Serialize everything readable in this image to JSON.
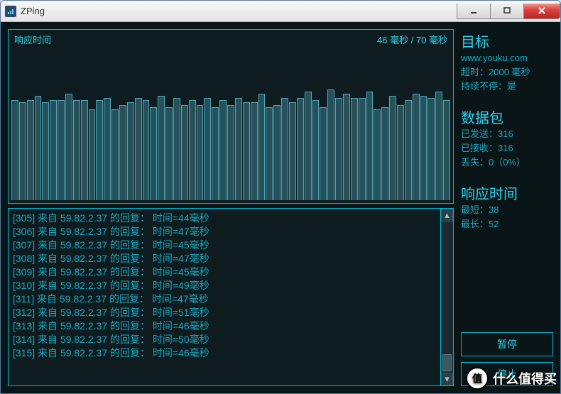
{
  "window": {
    "title": "ZPing"
  },
  "chart": {
    "label": "响应时间",
    "stats": "46 毫秒 / 70 毫秒"
  },
  "chart_data": {
    "type": "bar",
    "title": "响应时间",
    "ylabel": "毫秒",
    "ylim": [
      0,
      70
    ],
    "values": [
      46,
      45,
      46,
      48,
      45,
      46,
      46,
      49,
      46,
      46,
      42,
      46,
      47,
      42,
      44,
      45,
      47,
      46,
      43,
      48,
      43,
      47,
      44,
      46,
      44,
      47,
      43,
      46,
      44,
      47,
      45,
      45,
      49,
      43,
      44,
      47,
      45,
      47,
      50,
      46,
      43,
      51,
      47,
      49,
      47,
      47,
      50,
      42,
      43,
      48,
      44,
      46,
      49,
      48,
      47,
      50,
      46
    ]
  },
  "log": {
    "lines": [
      {
        "seq": 305,
        "ip": "59.82.2.37",
        "ms": 44
      },
      {
        "seq": 306,
        "ip": "59.82.2.37",
        "ms": 47
      },
      {
        "seq": 307,
        "ip": "59.82.2.37",
        "ms": 45
      },
      {
        "seq": 308,
        "ip": "59.82.2.37",
        "ms": 47
      },
      {
        "seq": 309,
        "ip": "59.82.2.37",
        "ms": 45
      },
      {
        "seq": 310,
        "ip": "59.82.2.37",
        "ms": 49
      },
      {
        "seq": 311,
        "ip": "59.82.2.37",
        "ms": 47
      },
      {
        "seq": 312,
        "ip": "59.82.2.37",
        "ms": 51
      },
      {
        "seq": 313,
        "ip": "59.82.2.37",
        "ms": 46
      },
      {
        "seq": 314,
        "ip": "59.82.2.37",
        "ms": 50
      },
      {
        "seq": 315,
        "ip": "59.82.2.37",
        "ms": 46
      }
    ],
    "template_prefix": "[",
    "template_mid1": "] 来自 ",
    "template_mid2": " 的回复： 时间=",
    "template_suffix": "毫秒"
  },
  "target": {
    "title": "目标",
    "host": "www.youku.com",
    "timeout_label": "超时：",
    "timeout_value": "2000 毫秒",
    "continuous_label": "持续不停：",
    "continuous_value": "是"
  },
  "packets": {
    "title": "数据包",
    "sent_label": "已发送：",
    "sent": 316,
    "recv_label": "已接收：",
    "recv": 316,
    "lost_label": "丢失：",
    "lost": "0（0%）"
  },
  "resp": {
    "title": "响应时间",
    "min_label": "最短：",
    "min": 38,
    "max_label": "最长：",
    "max": 52
  },
  "buttons": {
    "pause": "暂停",
    "stop": "停止"
  },
  "watermark": {
    "badge": "值",
    "text": "什么值得买"
  }
}
